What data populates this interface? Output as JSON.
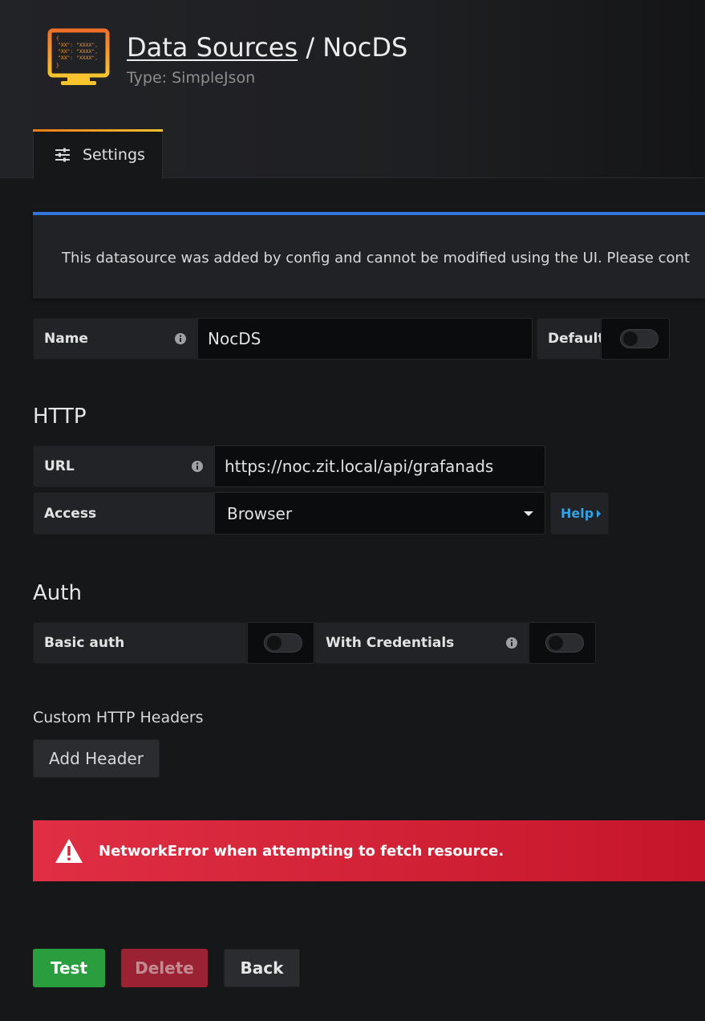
{
  "header": {
    "breadcrumb_link": "Data Sources",
    "separator": "/",
    "datasource_name": "NocDS",
    "subtitle": "Type: SimpleJson",
    "icon_name": "simplejson-monitor-icon",
    "icon_lines": [
      "{",
      "\"XX\": \"XXXX\",",
      "\"XX\": \"XXXX\",",
      "\"XX\": \"XXXX\",",
      "}"
    ]
  },
  "tabs": [
    {
      "label": "Settings",
      "icon": "sliders-icon",
      "active": true
    }
  ],
  "info_banner": {
    "text": "This datasource was added by config and cannot be modified using the UI. Please cont"
  },
  "name_row": {
    "label": "Name",
    "value": "NocDS",
    "default_label": "Default",
    "default_on": false
  },
  "http": {
    "title": "HTTP",
    "url_label": "URL",
    "url_value": "https://noc.zit.local/api/grafanads",
    "access_label": "Access",
    "access_value": "Browser",
    "help_label": "Help"
  },
  "auth": {
    "title": "Auth",
    "basic_auth_label": "Basic auth",
    "basic_auth_on": false,
    "with_credentials_label": "With Credentials",
    "with_credentials_on": false
  },
  "custom_headers": {
    "title": "Custom HTTP Headers",
    "add_button": "Add Header"
  },
  "error": {
    "text": "NetworkError when attempting to fetch resource."
  },
  "actions": {
    "test": "Test",
    "delete": "Delete",
    "back": "Back"
  },
  "colors": {
    "background": "#161719",
    "info_accent": "#3274d9",
    "error": "#e02f44",
    "test_button": "#2a9d3f",
    "delete_button": "#9b2233",
    "help_link": "#33a2e5",
    "tab_accent": "#eb7b18"
  }
}
